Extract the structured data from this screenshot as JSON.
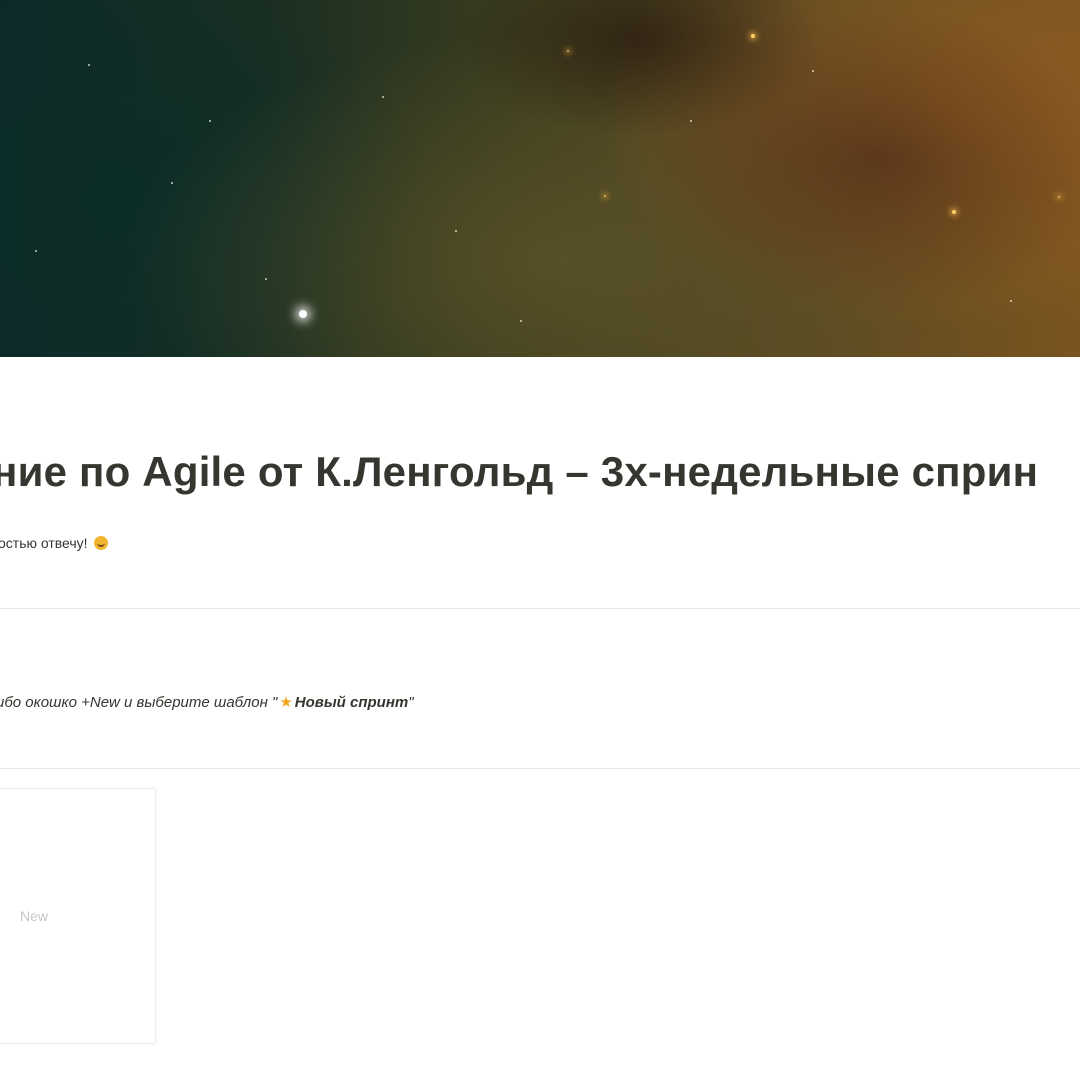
{
  "page": {
    "title": "ние по Agile от К.Ленгольд – 3х-недельные сприн",
    "subtitle": "остью отвечу!",
    "instruction_prefix": "ибо окошко +New и выберите шаблон \"",
    "instruction_template": "Новый спринт",
    "instruction_suffix": "\""
  },
  "board": {
    "new_label": "New"
  },
  "icons": {
    "subtitle_emoji": "smiling-face-icon",
    "template_star": "star-icon"
  },
  "colors": {
    "text": "#37352f",
    "divider": "#e9e9e7",
    "star_accent": "#f5a623",
    "placeholder": "#c7c7c5"
  }
}
